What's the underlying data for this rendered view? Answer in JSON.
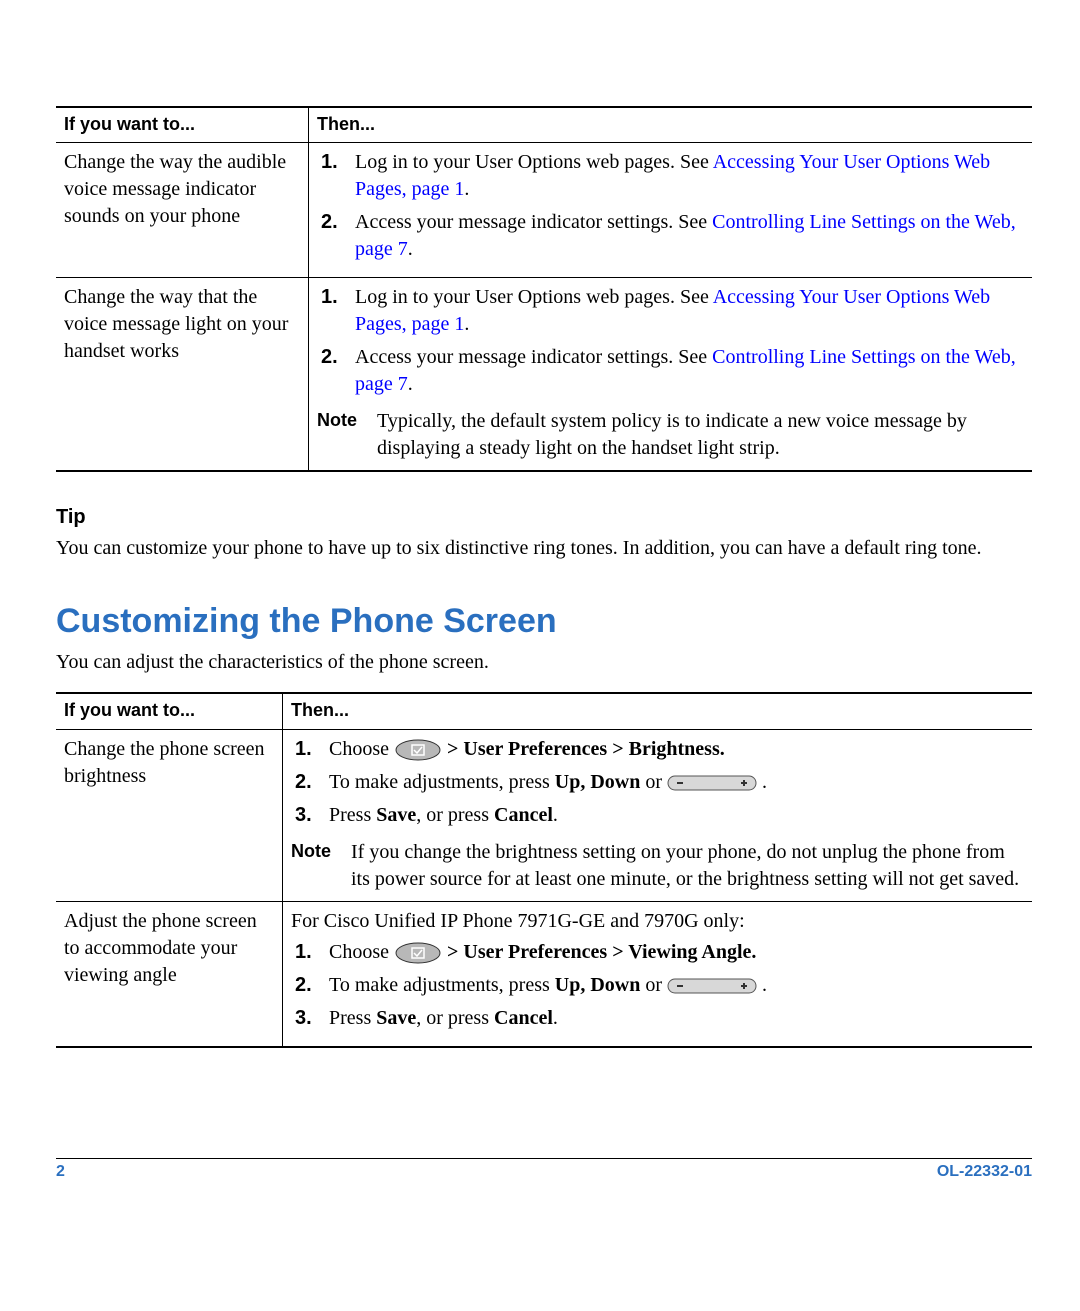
{
  "table1": {
    "headers": [
      "If you want to...",
      "Then..."
    ],
    "rows": [
      {
        "want": "Change the way the audible voice message indicator sounds on your phone",
        "steps": [
          {
            "pre": "Log in to your User Options web pages. See ",
            "link": "Accessing Your User Options Web Pages, page 1",
            "post": "."
          },
          {
            "pre": "Access your message indicator settings. See ",
            "link": "Controlling Line Settings on the Web, page 7",
            "post": "."
          }
        ]
      },
      {
        "want": "Change the way that the voice message light on your handset works",
        "steps": [
          {
            "pre": "Log in to your User Options web pages. See ",
            "link": "Accessing Your User Options Web Pages, page 1",
            "post": "."
          },
          {
            "pre": "Access your message indicator settings. See ",
            "link": "Controlling Line Settings on the Web, page 7",
            "post": "."
          }
        ],
        "noteLabel": "Note",
        "noteBody": "Typically, the default system policy is to indicate a new voice message by displaying a steady light on the handset light strip."
      }
    ]
  },
  "tip": {
    "heading": "Tip",
    "body": "You can customize your phone to have up to six distinctive ring tones. In addition, you can have a default ring tone."
  },
  "section": {
    "heading": "Customizing the Phone Screen",
    "intro": "You can adjust the characteristics of the phone screen."
  },
  "table2": {
    "headers": [
      "If you want to...",
      "Then..."
    ],
    "rows": [
      {
        "want": "Change the phone screen brightness",
        "step1": {
          "pre": "Choose ",
          "post": " > User Preferences > Brightness."
        },
        "step2": {
          "pre": "To make adjustments, press ",
          "updown": "Up, Down",
          "mid": " or ",
          "post": " ."
        },
        "step3": {
          "pre": "Press ",
          "save": "Save",
          "mid": ", or press ",
          "cancel": "Cancel",
          "post": "."
        },
        "noteLabel": "Note",
        "noteBody": "If you change the brightness setting on your phone, do not unplug the phone from its power source for at least one minute, or the brightness setting will not get saved."
      },
      {
        "want": "Adjust the phone screen to accommodate your viewing angle",
        "intro": "For Cisco Unified IP Phone 7971G-GE and 7970G only:",
        "step1": {
          "pre": "Choose ",
          "post": " > User Preferences > Viewing Angle."
        },
        "step2": {
          "pre": "To make adjustments, press ",
          "updown": "Up, Down",
          "mid": " or ",
          "post": " ."
        },
        "step3": {
          "pre": "Press ",
          "save": "Save",
          "mid": ", or press ",
          "cancel": "Cancel",
          "post": "."
        }
      }
    ]
  },
  "footer": {
    "pageNum": "2",
    "docId": "OL-22332-01"
  }
}
